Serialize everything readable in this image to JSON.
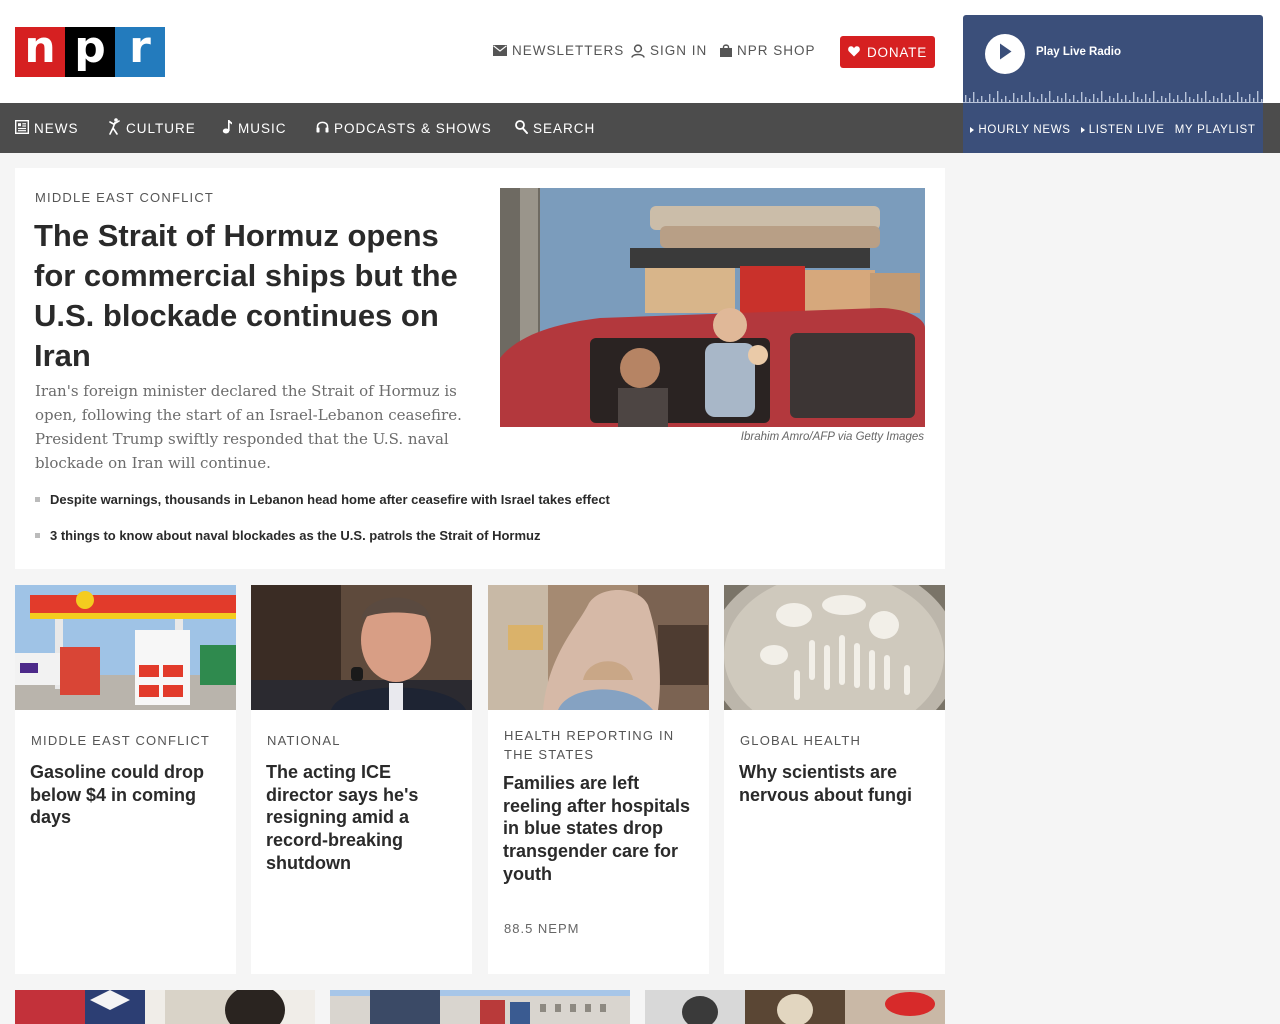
{
  "header": {
    "logo_letters": [
      "n",
      "p",
      "r"
    ],
    "newsletters_label": "NEWSLETTERS",
    "sign_in_label": "SIGN IN",
    "shop_label": "NPR SHOP",
    "donate_label": "DONATE"
  },
  "player": {
    "play_label": "Play Live Radio",
    "links": [
      "HOURLY NEWS",
      "LISTEN LIVE",
      "MY PLAYLIST"
    ]
  },
  "nav": {
    "items": [
      {
        "label": "NEWS",
        "icon": "newspaper-icon"
      },
      {
        "label": "CULTURE",
        "icon": "dancer-icon"
      },
      {
        "label": "MUSIC",
        "icon": "music-note-icon"
      },
      {
        "label": "PODCASTS & SHOWS",
        "icon": "headphones-icon"
      },
      {
        "label": "SEARCH",
        "icon": "search-icon"
      }
    ]
  },
  "hero": {
    "slug": "MIDDLE EAST CONFLICT",
    "title": "The Strait of Hormuz opens for commercial ships but the U.S. blockade continues on Iran",
    "teaser": "Iran's foreign minister declared the Strait of Hormuz is open, following the start of an Israel-Lebanon ceasefire. President Trump swiftly responded that the U.S. naval blockade on Iran will continue.",
    "image_credit": "Ibrahim Amro/AFP via Getty Images",
    "related": [
      "Despite warnings, thousands in Lebanon head home after ceasefire with Israel takes effect",
      "3 things to know about naval blockades as the U.S. patrols the Strait of Hormuz"
    ]
  },
  "cards": [
    {
      "slug": "MIDDLE EAST CONFLICT",
      "title": "Gasoline could drop below $4 in coming days",
      "source": ""
    },
    {
      "slug": "NATIONAL",
      "title": "The acting ICE director says he's resigning amid a record-breaking shutdown",
      "source": ""
    },
    {
      "slug": "HEALTH REPORTING IN THE STATES",
      "title": "Families are left reeling after hospitals in blue states drop transgender care for youth",
      "source": "88.5 NEPM"
    },
    {
      "slug": "GLOBAL HEALTH",
      "title": "Why scientists are nervous about fungi",
      "source": ""
    }
  ],
  "colors": {
    "brand_red": "#d62021",
    "brand_black": "#000000",
    "brand_blue": "#237bbd",
    "player_bg": "#3b4f7a",
    "nav_bg": "#4c4c4c"
  }
}
